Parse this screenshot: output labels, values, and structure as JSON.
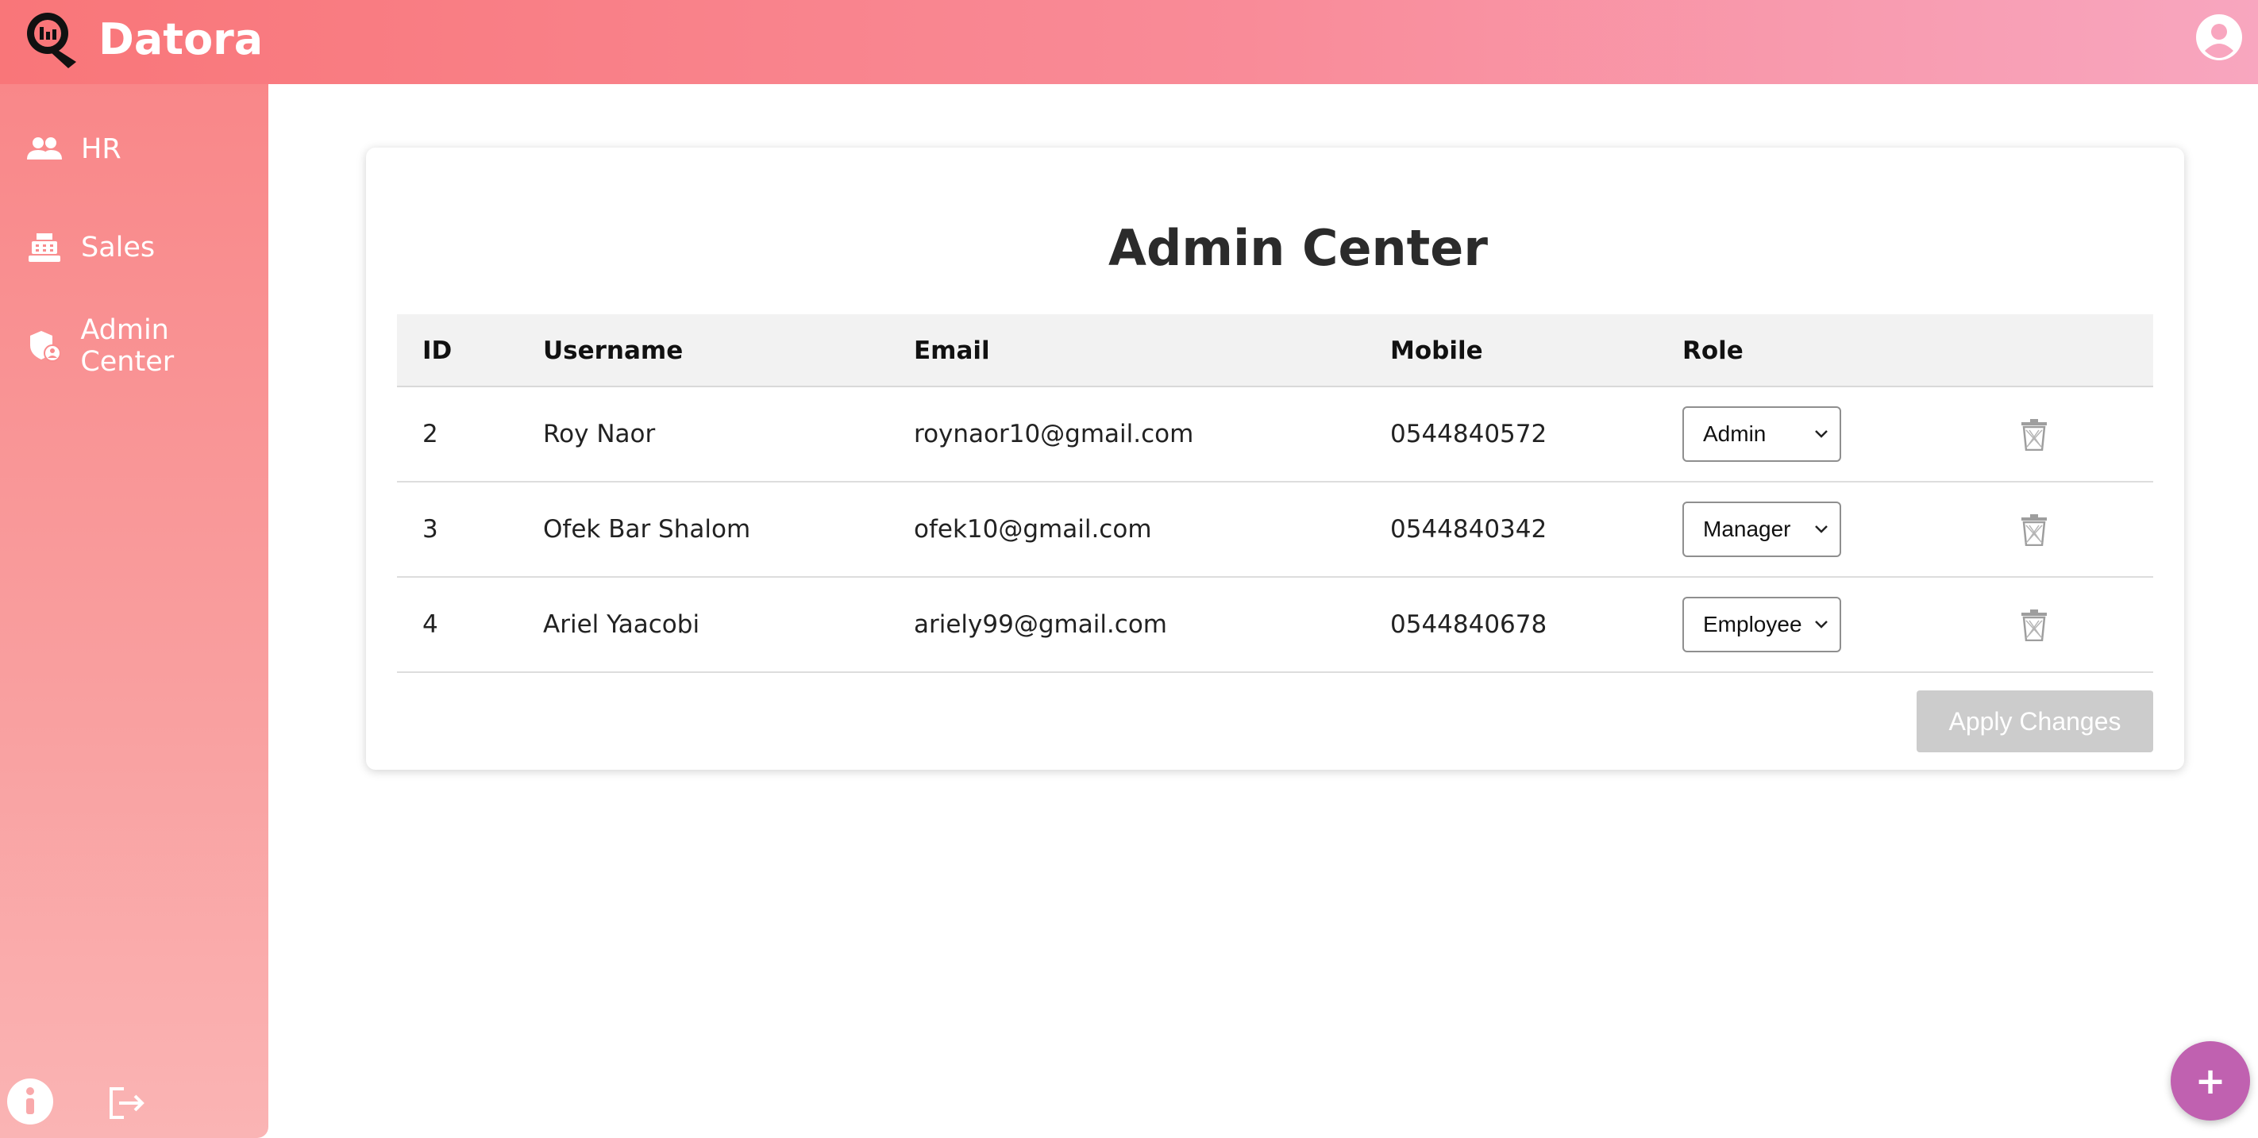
{
  "header": {
    "brand": "Datora",
    "logo_icon": "datora-logo-icon",
    "account_icon": "account-circle-icon",
    "gradient": [
      "#f97679",
      "#f8a6bf"
    ]
  },
  "sidebar": {
    "items": [
      {
        "label": "HR",
        "icon": "people-icon"
      },
      {
        "label": "Sales",
        "icon": "cash-register-icon"
      },
      {
        "label": "Admin Center",
        "icon": "admin-shield-icon"
      }
    ],
    "bottom": {
      "info_icon": "info-icon",
      "logout_icon": "logout-icon"
    }
  },
  "main": {
    "title": "Admin Center",
    "columns": {
      "id": "ID",
      "username": "Username",
      "email": "Email",
      "mobile": "Mobile",
      "role": "Role"
    },
    "rows": [
      {
        "id": "2",
        "username": "Roy Naor",
        "email": "roynaor10@gmail.com",
        "mobile": "0544840572",
        "role": "Admin"
      },
      {
        "id": "3",
        "username": "Ofek Bar Shalom",
        "email": "ofek10@gmail.com",
        "mobile": "0544840342",
        "role": "Manager"
      },
      {
        "id": "4",
        "username": "Ariel Yaacobi",
        "email": "ariely99@gmail.com",
        "mobile": "0544840678",
        "role": "Employee"
      }
    ],
    "apply_button": "Apply Changes",
    "apply_button_color": "#cccccc"
  },
  "fab": {
    "label": "+",
    "color": "#c061b0"
  }
}
